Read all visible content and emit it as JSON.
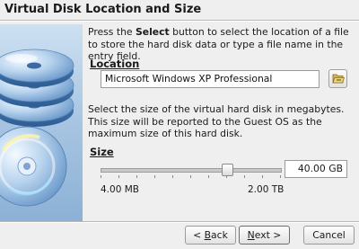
{
  "wizard": {
    "title": "Virtual Disk Location and Size",
    "intro_pre": "Press the ",
    "intro_bold": "Select",
    "intro_post": " button to select the location of a file to store the hard disk data or type a file name in the entry field.",
    "location_label": "Location",
    "location_value": "Microsoft Windows XP Professional",
    "size_description": "Select the size of the virtual hard disk in megabytes. This size will be reported to the Guest OS as the maximum size of this hard disk.",
    "size_label": "Size",
    "size_value": "40.00 GB",
    "size_fraction": 0.7,
    "min_label": "4.00 MB",
    "max_label": "2.00 TB"
  },
  "buttons": {
    "back_lt": "< ",
    "back_u": "B",
    "back_rest": "ack",
    "next_u": "N",
    "next_rest": "ext >",
    "cancel": "Cancel"
  },
  "icons": {
    "select_button": "folder-open-icon",
    "side_image": "disk-stack-image"
  }
}
